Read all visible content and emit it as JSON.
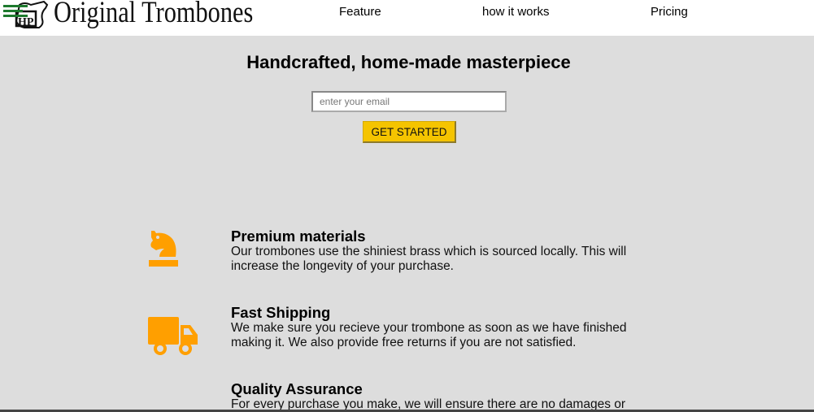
{
  "header": {
    "brand": "Original Trombones",
    "nav": [
      {
        "label": "Feature"
      },
      {
        "label": "how it works"
      },
      {
        "label": "Pricing"
      }
    ]
  },
  "hero": {
    "title": "Handcrafted, home-made masterpiece",
    "email_placeholder": "enter your email",
    "cta_label": "GET STARTED"
  },
  "features": [
    {
      "icon": "chess-knight-icon",
      "title": "Premium materials",
      "description": "Our trombones use the shiniest brass which is sourced locally. This will increase the longevity of your purchase."
    },
    {
      "icon": "truck-icon",
      "title": "Fast Shipping",
      "description": "We make sure you recieve your trombone as soon as we have finished making it. We also provide free returns if you are not satisfied."
    },
    {
      "icon": "",
      "title": "Quality Assurance",
      "description": "For every purchase you make, we will ensure there are no damages or"
    }
  ],
  "colors": {
    "accent": "#f5c400",
    "icon": "#ff9f00",
    "background": "#dddddd",
    "header_bg": "#ffffff"
  }
}
